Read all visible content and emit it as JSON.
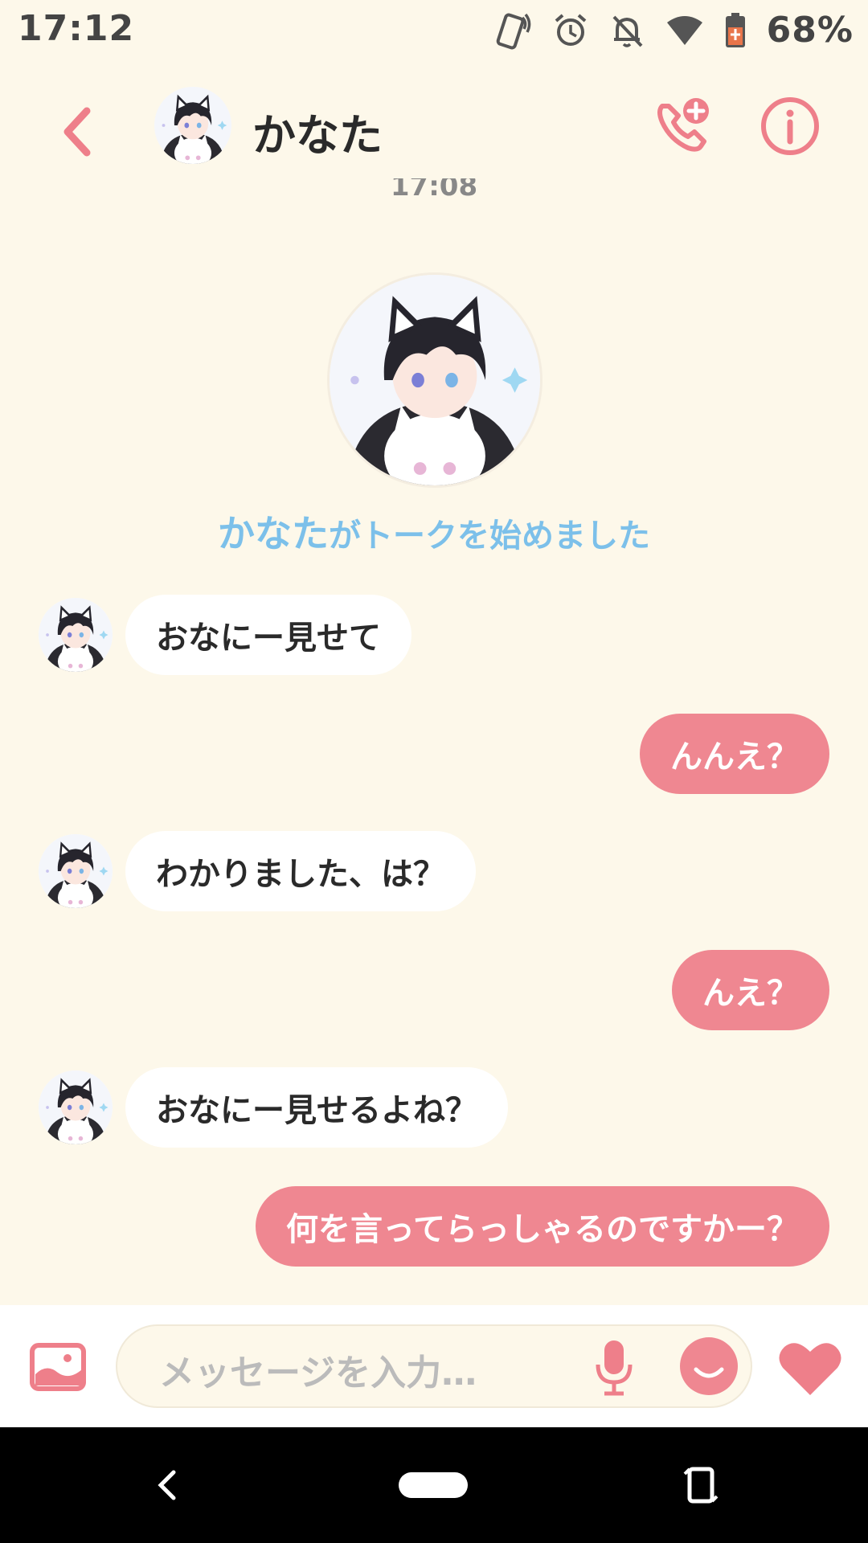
{
  "status_bar": {
    "time": "17:12",
    "battery_percent": "68%",
    "icons": [
      "vibrate-icon",
      "alarm-icon",
      "notifications-off-icon",
      "wifi-icon",
      "battery-icon"
    ]
  },
  "header": {
    "contact_name": "かなた",
    "icons": [
      "back-icon",
      "add-call-icon",
      "info-icon"
    ]
  },
  "conversation": {
    "time_divider": "17:08",
    "start_notice_name": "かなた",
    "start_notice_text": "がトークを始めました",
    "messages": [
      {
        "side": "in",
        "text": "おなにー見せて"
      },
      {
        "side": "out",
        "text": "んんえ？"
      },
      {
        "side": "in",
        "text": "わかりました、は？"
      },
      {
        "side": "out",
        "text": "んえ？"
      },
      {
        "side": "in",
        "text": "おなにー見せるよね？"
      },
      {
        "side": "out",
        "text": "何を言ってらっしゃるのですかー？"
      }
    ]
  },
  "input_bar": {
    "placeholder": "メッセージを入力…",
    "icons": [
      "image-icon",
      "mic-icon",
      "emoji-icon",
      "heart-icon"
    ]
  },
  "nav_bar": {
    "icons": [
      "nav-back-icon",
      "nav-home-pill",
      "rotate-icon"
    ]
  },
  "colors": {
    "background": "#fdf8ea",
    "accent_pink": "#ef8791",
    "notice_blue": "#7cc0ea",
    "incoming_bubble": "#ffffff"
  }
}
